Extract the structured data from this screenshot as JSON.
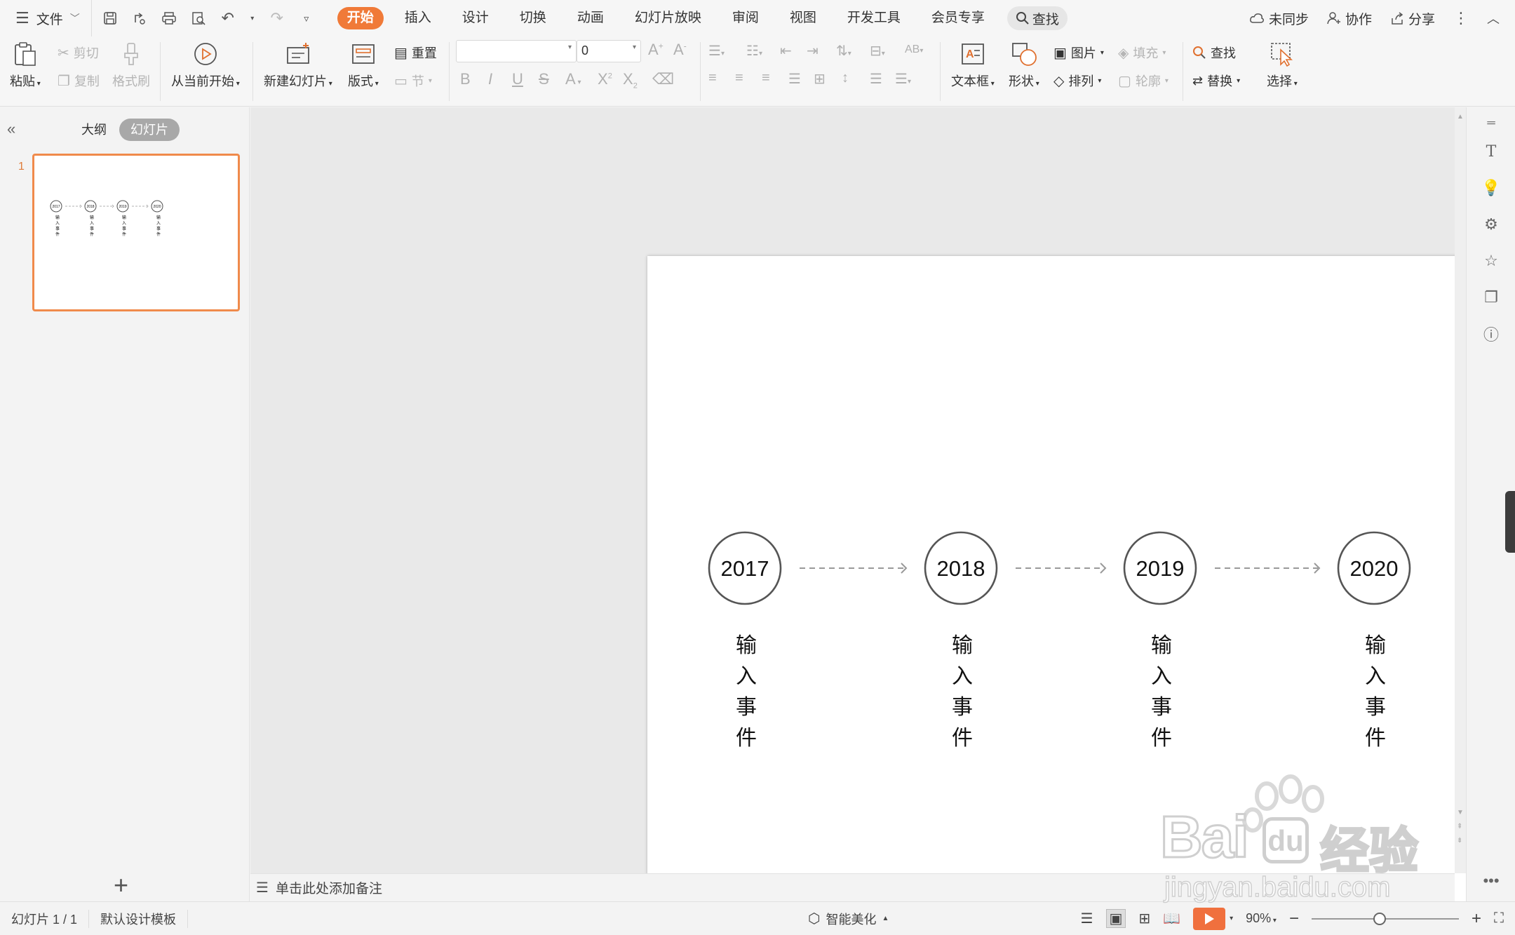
{
  "menubar": {
    "file_label": "文件",
    "tabs": [
      "开始",
      "插入",
      "设计",
      "切换",
      "动画",
      "幻灯片放映",
      "审阅",
      "视图",
      "开发工具",
      "会员专享"
    ],
    "search_label": "查找",
    "sync_label": "未同步",
    "collab_label": "协作",
    "share_label": "分享"
  },
  "ribbon": {
    "paste": "粘贴",
    "cut": "剪切",
    "copy": "复制",
    "format_painter": "格式刷",
    "from_current": "从当前开始",
    "new_slide": "新建幻灯片",
    "layout": "版式",
    "reset": "重置",
    "section": "节",
    "font_size_value": "0",
    "textbox": "文本框",
    "shape": "形状",
    "picture": "图片",
    "fill": "填充",
    "arrange": "排列",
    "outline": "轮廓",
    "find": "查找",
    "replace": "替换",
    "select": "选择"
  },
  "left_panel": {
    "outline_tab": "大纲",
    "slides_tab": "幻灯片",
    "slide_number": "1"
  },
  "slide": {
    "timeline": [
      {
        "year": "2017",
        "event": [
          "输",
          "入",
          "事",
          "件"
        ]
      },
      {
        "year": "2018",
        "event": [
          "输",
          "入",
          "事",
          "件"
        ]
      },
      {
        "year": "2019",
        "event": [
          "输",
          "入",
          "事",
          "件"
        ]
      },
      {
        "year": "2020",
        "event": [
          "输",
          "入",
          "事",
          "件"
        ]
      }
    ]
  },
  "notes_placeholder": "单击此处添加备注",
  "statusbar": {
    "slide_count": "幻灯片 1 / 1",
    "template": "默认设计模板",
    "smart_beautify": "智能美化",
    "zoom": "90%"
  },
  "watermark": {
    "brand": "Bai",
    "brand_suffix": "经验",
    "url": "jingyan.baidu.com"
  }
}
